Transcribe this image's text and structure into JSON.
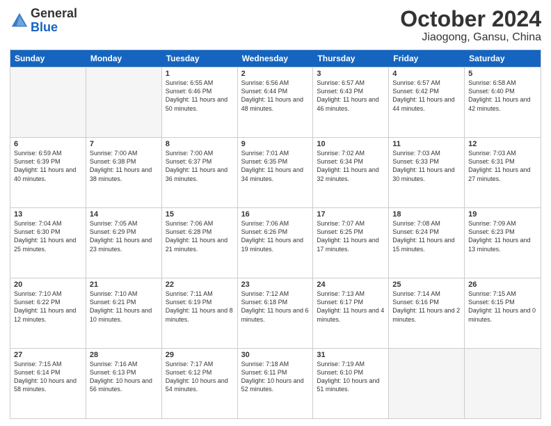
{
  "header": {
    "logo_general": "General",
    "logo_blue": "Blue",
    "month_title": "October 2024",
    "location": "Jiaogong, Gansu, China"
  },
  "days_of_week": [
    "Sunday",
    "Monday",
    "Tuesday",
    "Wednesday",
    "Thursday",
    "Friday",
    "Saturday"
  ],
  "weeks": [
    [
      {
        "day": "",
        "empty": true
      },
      {
        "day": "",
        "empty": true
      },
      {
        "day": "1",
        "sunrise": "6:55 AM",
        "sunset": "6:46 PM",
        "daylight": "11 hours and 50 minutes."
      },
      {
        "day": "2",
        "sunrise": "6:56 AM",
        "sunset": "6:44 PM",
        "daylight": "11 hours and 48 minutes."
      },
      {
        "day": "3",
        "sunrise": "6:57 AM",
        "sunset": "6:43 PM",
        "daylight": "11 hours and 46 minutes."
      },
      {
        "day": "4",
        "sunrise": "6:57 AM",
        "sunset": "6:42 PM",
        "daylight": "11 hours and 44 minutes."
      },
      {
        "day": "5",
        "sunrise": "6:58 AM",
        "sunset": "6:40 PM",
        "daylight": "11 hours and 42 minutes."
      }
    ],
    [
      {
        "day": "6",
        "sunrise": "6:59 AM",
        "sunset": "6:39 PM",
        "daylight": "11 hours and 40 minutes."
      },
      {
        "day": "7",
        "sunrise": "7:00 AM",
        "sunset": "6:38 PM",
        "daylight": "11 hours and 38 minutes."
      },
      {
        "day": "8",
        "sunrise": "7:00 AM",
        "sunset": "6:37 PM",
        "daylight": "11 hours and 36 minutes."
      },
      {
        "day": "9",
        "sunrise": "7:01 AM",
        "sunset": "6:35 PM",
        "daylight": "11 hours and 34 minutes."
      },
      {
        "day": "10",
        "sunrise": "7:02 AM",
        "sunset": "6:34 PM",
        "daylight": "11 hours and 32 minutes."
      },
      {
        "day": "11",
        "sunrise": "7:03 AM",
        "sunset": "6:33 PM",
        "daylight": "11 hours and 30 minutes."
      },
      {
        "day": "12",
        "sunrise": "7:03 AM",
        "sunset": "6:31 PM",
        "daylight": "11 hours and 27 minutes."
      }
    ],
    [
      {
        "day": "13",
        "sunrise": "7:04 AM",
        "sunset": "6:30 PM",
        "daylight": "11 hours and 25 minutes."
      },
      {
        "day": "14",
        "sunrise": "7:05 AM",
        "sunset": "6:29 PM",
        "daylight": "11 hours and 23 minutes."
      },
      {
        "day": "15",
        "sunrise": "7:06 AM",
        "sunset": "6:28 PM",
        "daylight": "11 hours and 21 minutes."
      },
      {
        "day": "16",
        "sunrise": "7:06 AM",
        "sunset": "6:26 PM",
        "daylight": "11 hours and 19 minutes."
      },
      {
        "day": "17",
        "sunrise": "7:07 AM",
        "sunset": "6:25 PM",
        "daylight": "11 hours and 17 minutes."
      },
      {
        "day": "18",
        "sunrise": "7:08 AM",
        "sunset": "6:24 PM",
        "daylight": "11 hours and 15 minutes."
      },
      {
        "day": "19",
        "sunrise": "7:09 AM",
        "sunset": "6:23 PM",
        "daylight": "11 hours and 13 minutes."
      }
    ],
    [
      {
        "day": "20",
        "sunrise": "7:10 AM",
        "sunset": "6:22 PM",
        "daylight": "11 hours and 12 minutes."
      },
      {
        "day": "21",
        "sunrise": "7:10 AM",
        "sunset": "6:21 PM",
        "daylight": "11 hours and 10 minutes."
      },
      {
        "day": "22",
        "sunrise": "7:11 AM",
        "sunset": "6:19 PM",
        "daylight": "11 hours and 8 minutes."
      },
      {
        "day": "23",
        "sunrise": "7:12 AM",
        "sunset": "6:18 PM",
        "daylight": "11 hours and 6 minutes."
      },
      {
        "day": "24",
        "sunrise": "7:13 AM",
        "sunset": "6:17 PM",
        "daylight": "11 hours and 4 minutes."
      },
      {
        "day": "25",
        "sunrise": "7:14 AM",
        "sunset": "6:16 PM",
        "daylight": "11 hours and 2 minutes."
      },
      {
        "day": "26",
        "sunrise": "7:15 AM",
        "sunset": "6:15 PM",
        "daylight": "11 hours and 0 minutes."
      }
    ],
    [
      {
        "day": "27",
        "sunrise": "7:15 AM",
        "sunset": "6:14 PM",
        "daylight": "10 hours and 58 minutes."
      },
      {
        "day": "28",
        "sunrise": "7:16 AM",
        "sunset": "6:13 PM",
        "daylight": "10 hours and 56 minutes."
      },
      {
        "day": "29",
        "sunrise": "7:17 AM",
        "sunset": "6:12 PM",
        "daylight": "10 hours and 54 minutes."
      },
      {
        "day": "30",
        "sunrise": "7:18 AM",
        "sunset": "6:11 PM",
        "daylight": "10 hours and 52 minutes."
      },
      {
        "day": "31",
        "sunrise": "7:19 AM",
        "sunset": "6:10 PM",
        "daylight": "10 hours and 51 minutes."
      },
      {
        "day": "",
        "empty": true
      },
      {
        "day": "",
        "empty": true
      }
    ]
  ]
}
